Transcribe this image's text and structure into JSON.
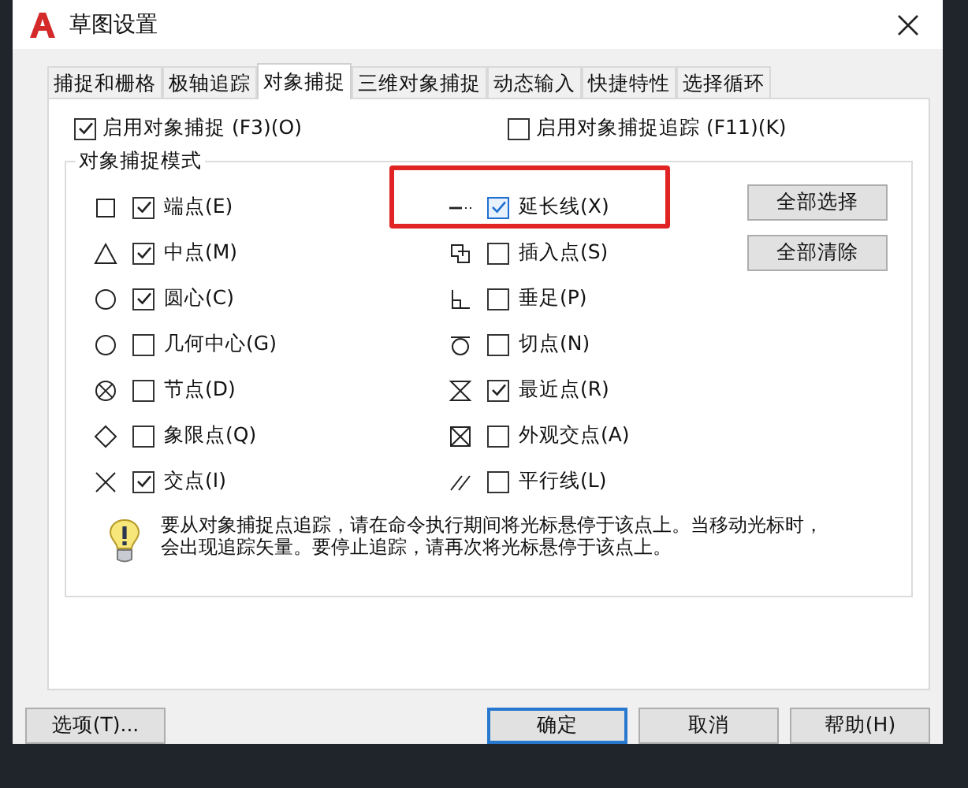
{
  "window": {
    "title": "草图设置"
  },
  "tabs": [
    {
      "label": "捕捉和栅格",
      "selected": false
    },
    {
      "label": "极轴追踪",
      "selected": false
    },
    {
      "label": "对象捕捉",
      "selected": true
    },
    {
      "label": "三维对象捕捉",
      "selected": false
    },
    {
      "label": "动态输入",
      "selected": false
    },
    {
      "label": "快捷特性",
      "selected": false
    },
    {
      "label": "选择循环",
      "selected": false
    }
  ],
  "enable_options": [
    {
      "label": "启用对象捕捉 (F3)(O)",
      "checked": true
    },
    {
      "label": "启用对象捕捉追踪 (F11)(K)",
      "checked": false
    }
  ],
  "group": {
    "title": "对象捕捉模式",
    "modes": [
      {
        "kind": "square",
        "label": "端点(E)",
        "checked": true,
        "highlighted": false
      },
      {
        "kind": "triangle",
        "label": "中点(M)",
        "checked": true,
        "highlighted": false
      },
      {
        "kind": "circle",
        "label": "圆心(C)",
        "checked": true,
        "highlighted": false
      },
      {
        "kind": "circle",
        "label": "几何中心(G)",
        "checked": false,
        "highlighted": false
      },
      {
        "kind": "node",
        "label": "节点(D)",
        "checked": false,
        "highlighted": false
      },
      {
        "kind": "diamond",
        "label": "象限点(Q)",
        "checked": false,
        "highlighted": false
      },
      {
        "kind": "cross",
        "label": "交点(I)",
        "checked": true,
        "highlighted": false
      },
      {
        "kind": "extension",
        "label": "延长线(X)",
        "checked": true,
        "highlighted": true
      },
      {
        "kind": "insert",
        "label": "插入点(S)",
        "checked": false,
        "highlighted": false
      },
      {
        "kind": "perpendicular",
        "label": "垂足(P)",
        "checked": false,
        "highlighted": false
      },
      {
        "kind": "tangent",
        "label": "切点(N)",
        "checked": false,
        "highlighted": false
      },
      {
        "kind": "nearest",
        "label": "最近点(R)",
        "checked": true,
        "highlighted": false
      },
      {
        "kind": "apparent",
        "label": "外观交点(A)",
        "checked": false,
        "highlighted": false
      },
      {
        "kind": "parallel",
        "label": "平行线(L)",
        "checked": false,
        "highlighted": false
      }
    ],
    "buttons": [
      "全部选择",
      "全部清除"
    ],
    "hint": "要从对象捕捉点追踪，请在命令执行期间将光标悬停于该点上。当移动光标时，会出现追踪矢量。要停止追踪，请再次将光标悬停于该点上。"
  },
  "footer_buttons": [
    {
      "label": "选项(T)...",
      "default": false
    },
    {
      "label": "确定",
      "default": true
    },
    {
      "label": "取消",
      "default": false
    },
    {
      "label": "帮助(H)",
      "default": false
    }
  ]
}
